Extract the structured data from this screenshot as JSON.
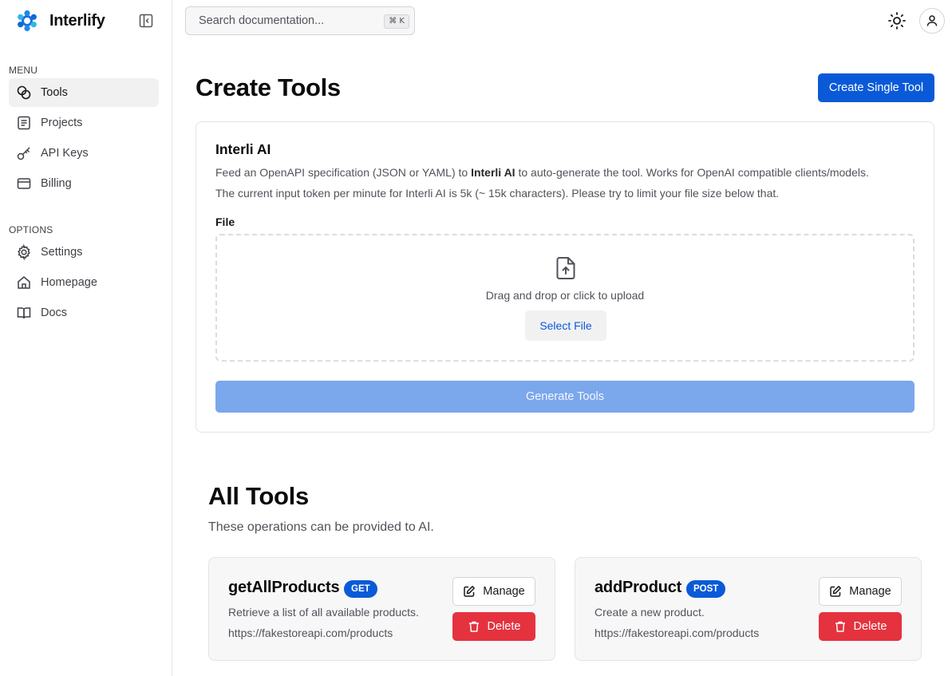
{
  "app": {
    "name": "Interlify"
  },
  "sidebar": {
    "menu_label": "MENU",
    "options_label": "OPTIONS",
    "menu_items": [
      {
        "label": "Tools",
        "icon": "tools-icon",
        "active": true
      },
      {
        "label": "Projects",
        "icon": "projects-icon"
      },
      {
        "label": "API Keys",
        "icon": "key-icon"
      },
      {
        "label": "Billing",
        "icon": "credit-card-icon"
      }
    ],
    "option_items": [
      {
        "label": "Settings",
        "icon": "gear-icon"
      },
      {
        "label": "Homepage",
        "icon": "home-icon"
      },
      {
        "label": "Docs",
        "icon": "book-icon"
      }
    ]
  },
  "topbar": {
    "search_placeholder": "Search documentation...",
    "search_shortcut": "⌘ K"
  },
  "page": {
    "title": "Create Tools",
    "create_single_label": "Create Single Tool"
  },
  "ai_card": {
    "title": "Interli AI",
    "desc_prefix": "Feed an OpenAPI specification (JSON or YAML) to ",
    "desc_bold": "Interli AI",
    "desc_suffix": " to auto-generate the tool. Works for OpenAI compatible clients/models.",
    "desc_line2": "The current input token per minute for Interli AI is 5k (~ 15k characters). Please try to limit your file size below that.",
    "file_label": "File",
    "drop_text": "Drag and drop or click to upload",
    "select_label": "Select File",
    "generate_label": "Generate Tools"
  },
  "tools_section": {
    "title": "All Tools",
    "subtitle": "These operations can be provided to AI.",
    "manage_label": "Manage",
    "delete_label": "Delete",
    "tools": [
      {
        "name": "getAllProducts",
        "method": "GET",
        "description": "Retrieve a list of all available products.",
        "url": "https://fakestoreapi.com/products"
      },
      {
        "name": "addProduct",
        "method": "POST",
        "description": "Create a new product.",
        "url": "https://fakestoreapi.com/products"
      }
    ]
  },
  "colors": {
    "primary": "#0a5ad8",
    "primary_disabled": "#7ba7ec",
    "danger": "#e5323f",
    "sidebar_active": "#f1f1f2"
  }
}
